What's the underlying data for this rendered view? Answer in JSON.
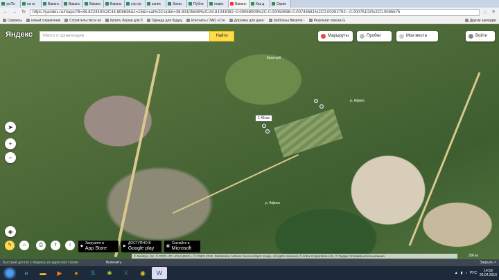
{
  "browser": {
    "tabs": [
      {
        "label": "ys.По"
      },
      {
        "label": "на ск"
      },
      {
        "label": "Ваканс"
      },
      {
        "label": "Ваканс"
      },
      {
        "label": "Ваканс"
      },
      {
        "label": "Ваканс"
      },
      {
        "label": "спр пр"
      },
      {
        "label": "запис"
      },
      {
        "label": "Запис"
      },
      {
        "label": "Публи"
      },
      {
        "label": "яндек"
      },
      {
        "label": "Ваканс"
      },
      {
        "label": "Как д"
      },
      {
        "label": "Скрин"
      }
    ],
    "url": "https://yandex.ru/maps/?ll=38.822443%2C44.808636&z=15&l=sat%2Cskl&rl=38.83105849%2C44.81043082~0.00059009%2C-0.00052698~0.00744581%2C0.00252792~-0.00075102%2C0.0055575",
    "bookmarks": [
      {
        "label": "Сервисы"
      },
      {
        "label": "новый справочник"
      },
      {
        "label": "Строительство и не"
      },
      {
        "label": "Купить блузки для б"
      },
      {
        "label": "Одежда для будущ"
      },
      {
        "label": "Контакты / ЗАО «Сте"
      },
      {
        "label": "Дорожка для дачи: "
      },
      {
        "label": "Шаблоны Визиток -"
      },
      {
        "label": "Результат поиска G"
      }
    ],
    "other_bookmarks": "Другие закладки"
  },
  "map": {
    "logo": "Яндекс",
    "search_placeholder": "Место и организации",
    "find_label": "Найти",
    "routes_label": "Маршруты",
    "traffic_label": "Пробки",
    "places_label": "Мои места",
    "login_label": "Войти",
    "distance_label": "1.45 км",
    "labels": [
      "Красный",
      "р. Афипс",
      "р. Афипс"
    ],
    "copyright": "© GeoEye, Inc. © ООО «ГС «СКАНЕКС», © CNES 2013, Distribution Astrium Services/Spot Image, All rights reserved, © Antrix Corporation Ltd., © Яндекс Условия использования",
    "scale": "300 м",
    "badges": [
      {
        "small": "Загрузите в",
        "big": "App Store"
      },
      {
        "small": "ДОСТУПНО В",
        "big": "Google play"
      },
      {
        "small": "Скачайте в",
        "big": "Microsoft"
      }
    ]
  },
  "notification": {
    "text": "Быстрый доступ к Яндексу из адресной строки",
    "accept": "Включить",
    "close": "Закрыть ×"
  },
  "taskbar": {
    "lang": "РУС",
    "time": "14:59",
    "date": "26.04.2016"
  }
}
